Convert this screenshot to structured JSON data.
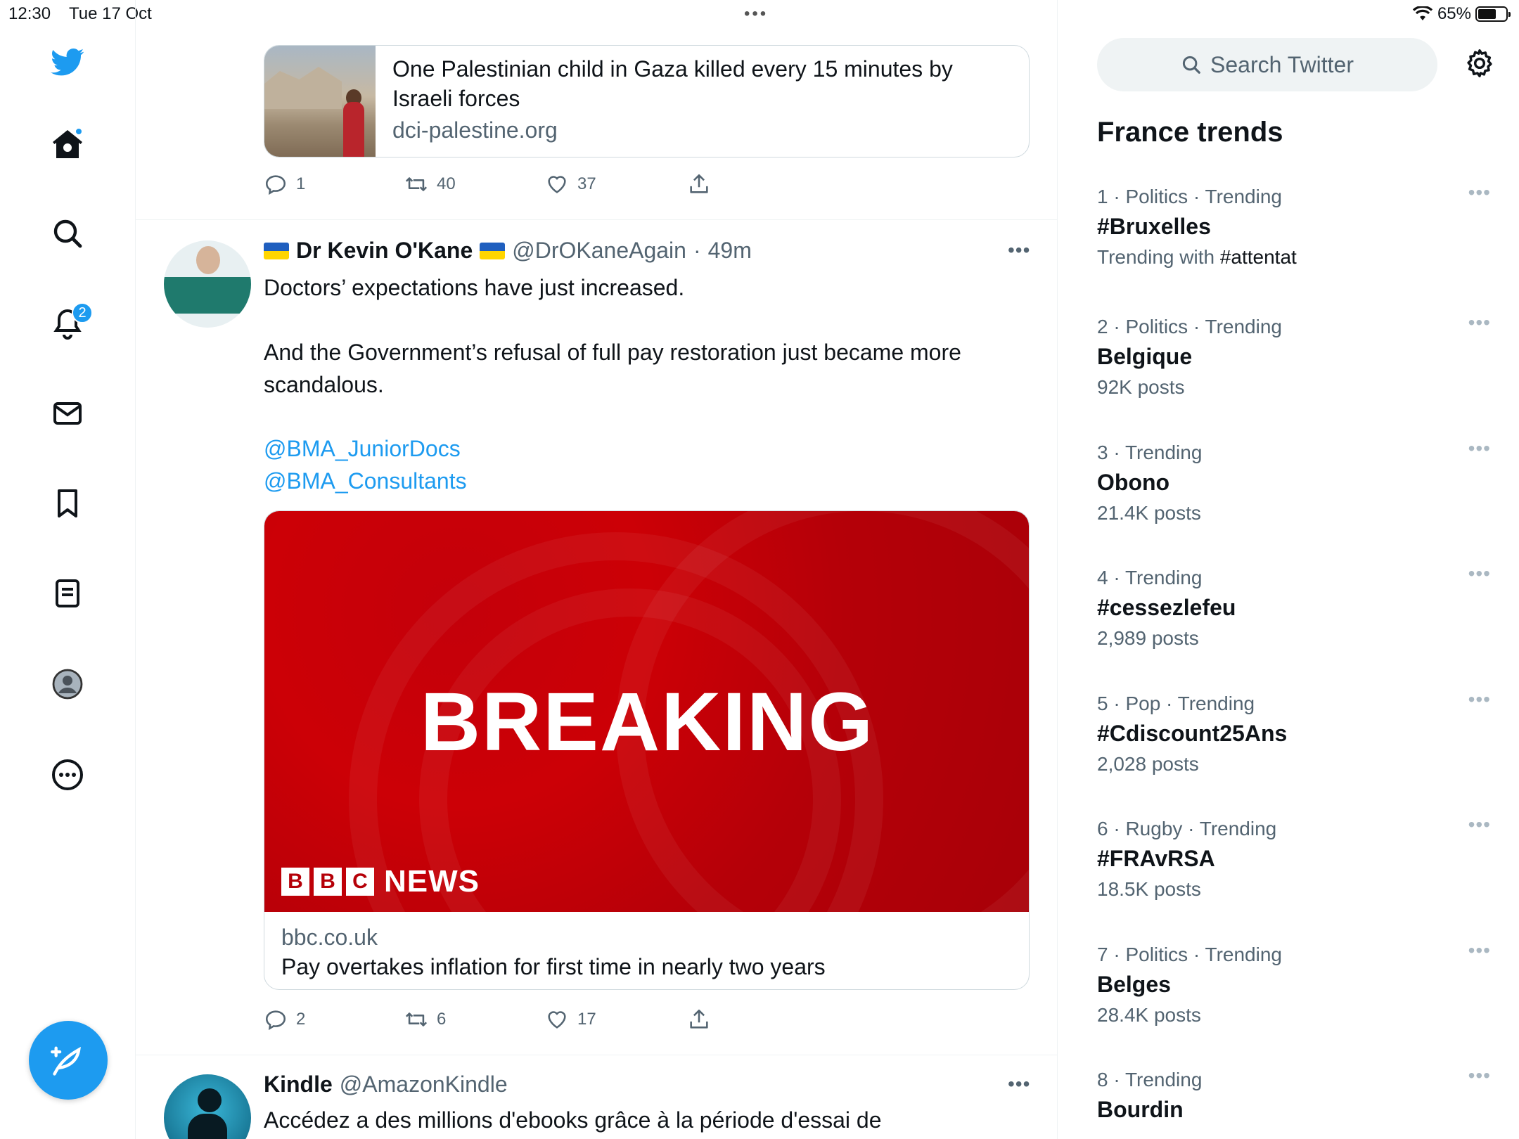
{
  "status": {
    "time": "12:30",
    "date": "Tue 17 Oct",
    "battery": "65%",
    "battery_level": 0.65,
    "multitask": "•••"
  },
  "nav": {
    "notifications_badge": "2"
  },
  "tweets": [
    {
      "link_card": {
        "title": "One Palestinian child in Gaza killed every 15 minutes by Israeli forces",
        "domain": "dci-palestine.org"
      },
      "actions": {
        "replies": "1",
        "retweets": "40",
        "likes": "37"
      }
    },
    {
      "display_name": "Dr Kevin O'Kane",
      "handle": "@DrOKaneAgain",
      "time": "49m",
      "text_1": "Doctors’ expectations have just increased.",
      "text_2": "And the Government’s refusal of full pay restoration just became more\nscandalous.",
      "mention_1": "@BMA_JuniorDocs",
      "mention_2": "@BMA_Consultants",
      "media_card": {
        "image_headline": "BREAKING",
        "image_brand_blocks": [
          "B",
          "B",
          "C"
        ],
        "image_brand_news": "NEWS",
        "domain": "bbc.co.uk",
        "title": "Pay overtakes inflation for first time in nearly two years"
      },
      "actions": {
        "replies": "2",
        "retweets": "6",
        "likes": "17"
      }
    },
    {
      "display_name": "Kindle",
      "handle": "@AmazonKindle",
      "text_1": "Accédez a des millions d'ebooks grâce à la période d'essai de"
    }
  ],
  "more_glyph": "•••",
  "sidebar": {
    "search_placeholder": "Search Twitter",
    "trends_title": "France trends",
    "trends": [
      {
        "meta": "1 · Politics · Trending",
        "name": "#Bruxelles",
        "posts_prefix": "Trending with ",
        "posts_bold": "#attentat"
      },
      {
        "meta": "2 · Politics · Trending",
        "name": "Belgique",
        "posts": "92K posts"
      },
      {
        "meta": "3 · Trending",
        "name": "Obono",
        "posts": "21.4K posts"
      },
      {
        "meta": "4 · Trending",
        "name": "#cessezlefeu",
        "posts": "2,989 posts"
      },
      {
        "meta": "5 · Pop · Trending",
        "name": "#Cdiscount25Ans",
        "posts": "2,028 posts"
      },
      {
        "meta": "6 · Rugby · Trending",
        "name": "#FRAvRSA",
        "posts": "18.5K posts"
      },
      {
        "meta": "7 · Politics · Trending",
        "name": "Belges",
        "posts": "28.4K posts"
      },
      {
        "meta": "8 · Trending",
        "name": "Bourdin"
      }
    ]
  },
  "colors": {
    "accent": "#1d9bf0",
    "text_secondary": "#536471",
    "bbc_red": "#bb0008"
  }
}
